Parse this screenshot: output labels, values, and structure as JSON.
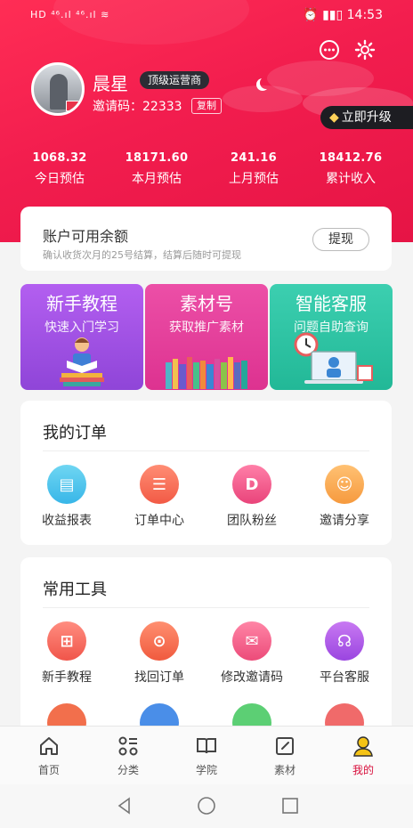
{
  "status": {
    "left_text": "HD ⁴⁶.ıl ⁴⁶.ıl ≋",
    "right_text": "⏰ ▮▮▯ 14:53"
  },
  "profile": {
    "name": "晨星",
    "level_badge": "顶级运营商",
    "invite_code": "邀请码：22333",
    "copy_label": "复制",
    "upgrade_label": "立即升级"
  },
  "stats": [
    {
      "value": "1068.32",
      "label": "今日预估"
    },
    {
      "value": "18171.60",
      "label": "本月预估"
    },
    {
      "value": "241.16",
      "label": "上月预估"
    },
    {
      "value": "18412.76",
      "label": "累计收入"
    }
  ],
  "balance": {
    "title": "账户可用余额",
    "subtitle": "确认收货次月的25号结算，结算后随时可提现",
    "withdraw_label": "提现"
  },
  "promo_cards": [
    {
      "title": "新手教程",
      "subtitle": "快速入门学习"
    },
    {
      "title": "素材号",
      "subtitle": "获取推广素材"
    },
    {
      "title": "智能客服",
      "subtitle": "问题自助查询"
    }
  ],
  "orders": {
    "title": "我的订单",
    "items": [
      {
        "label": "收益报表",
        "icon": "report-icon"
      },
      {
        "label": "订单中心",
        "icon": "order-list-icon"
      },
      {
        "label": "团队粉丝",
        "icon": "team-shield-icon"
      },
      {
        "label": "邀请分享",
        "icon": "invite-people-icon"
      }
    ]
  },
  "tools": {
    "title": "常用工具",
    "items": [
      {
        "label": "新手教程",
        "icon": "gift-icon"
      },
      {
        "label": "找回订单",
        "icon": "search-order-icon"
      },
      {
        "label": "修改邀请码",
        "icon": "mail-icon"
      },
      {
        "label": "平台客服",
        "icon": "headset-icon"
      }
    ]
  },
  "tabs": [
    {
      "label": "首页",
      "icon": "home-icon"
    },
    {
      "label": "分类",
      "icon": "category-icon"
    },
    {
      "label": "学院",
      "icon": "book-icon"
    },
    {
      "label": "素材",
      "icon": "edit-icon"
    },
    {
      "label": "我的",
      "icon": "profile-icon"
    }
  ],
  "colors": {
    "brand": "#f21d4e",
    "active_tab": "#d80f3c",
    "card_purple": "#a657e8",
    "card_pink": "#e8429c",
    "card_teal": "#2bc6a6"
  }
}
